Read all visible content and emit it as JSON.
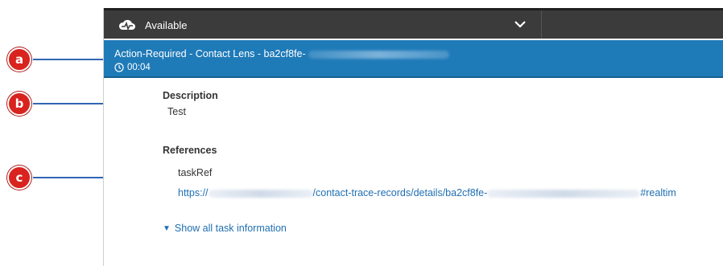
{
  "callouts": [
    "a",
    "b",
    "c"
  ],
  "status": {
    "label": "Available",
    "icon": "cloud-pulse-icon",
    "dropdown_icon": "chevron-down-icon"
  },
  "contact": {
    "title_prefix": "Action-Required - Contact Lens - ba2cf8fe-",
    "timer": "00:04",
    "bar_color": "#1f7ab8"
  },
  "description": {
    "label": "Description",
    "value": "Test"
  },
  "references": {
    "label": "References",
    "key": "taskRef",
    "link_parts": [
      "https://",
      "/contact-trace-records/details/ba2cf8fe-",
      "#realtim"
    ]
  },
  "show_all": "Show all task information",
  "colors": {
    "accent": "#1f7ab8",
    "link": "#1f6fb2",
    "callout": "#d8231f",
    "callout_line": "#2f66b3"
  }
}
